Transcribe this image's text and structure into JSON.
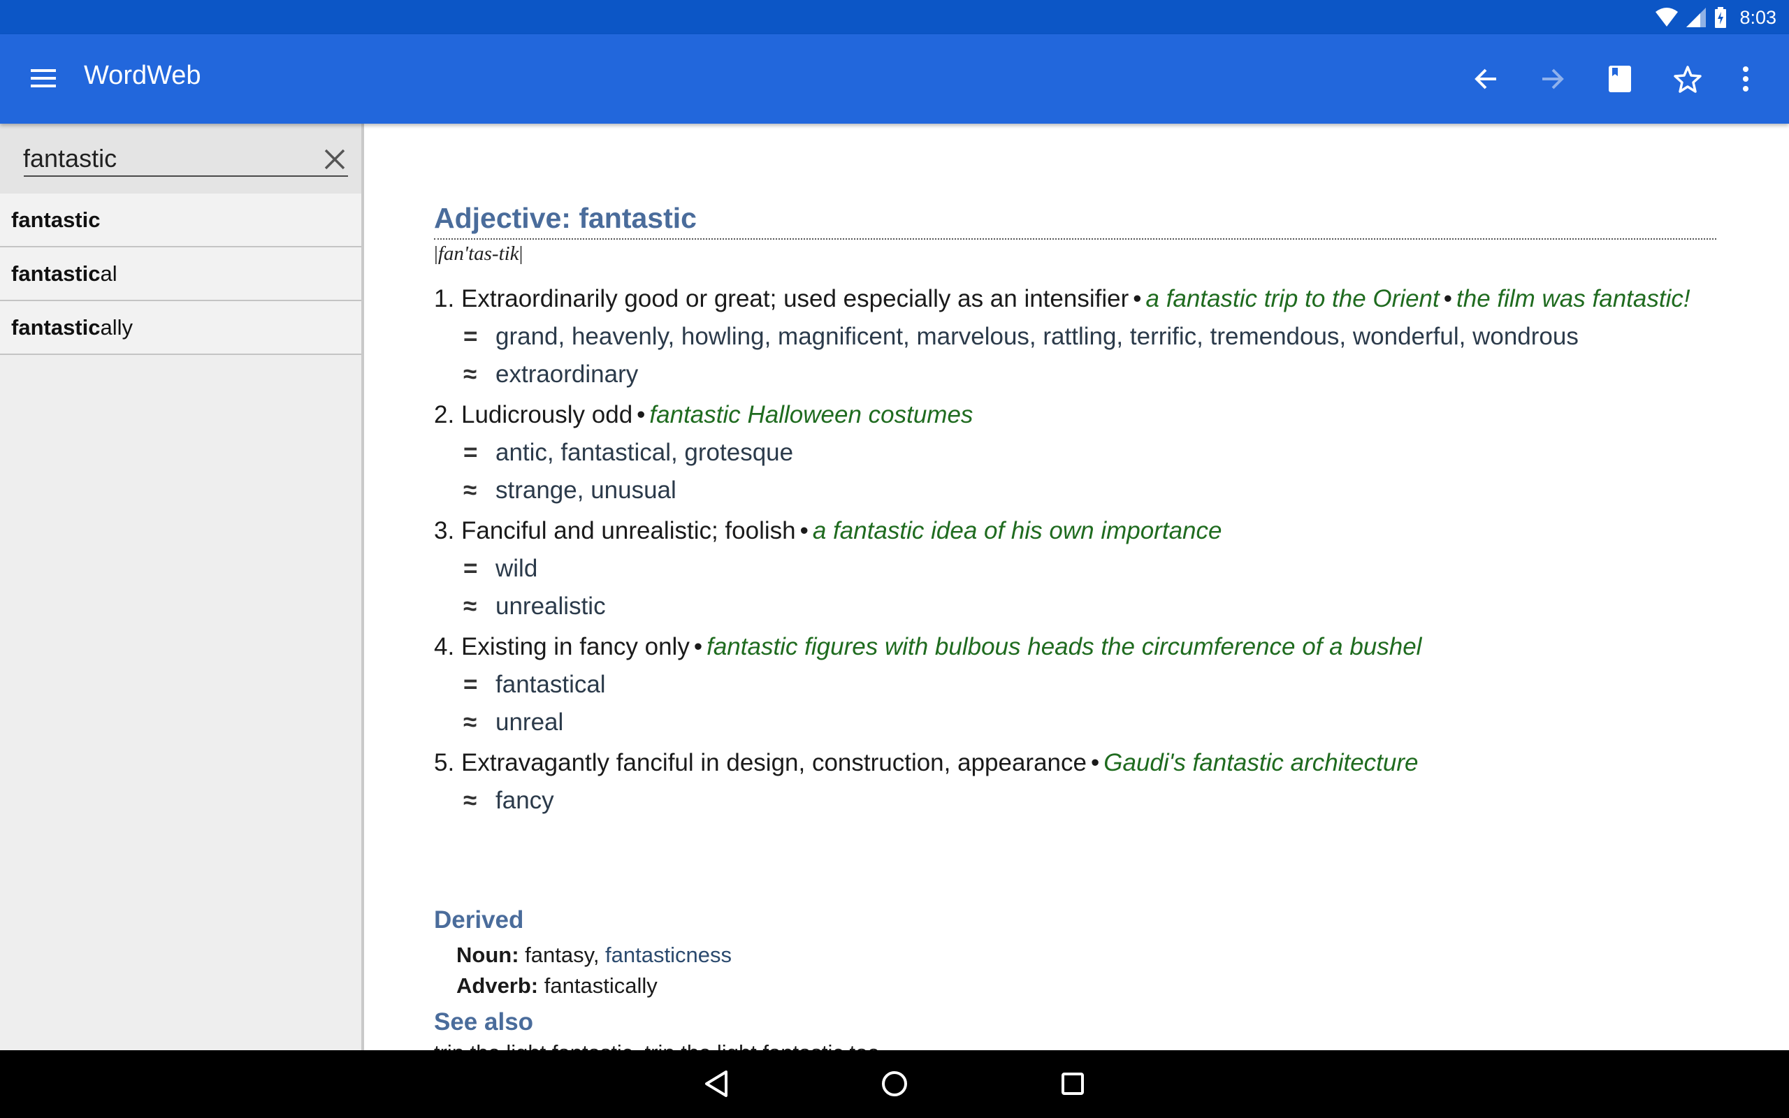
{
  "status_bar": {
    "time": "8:03",
    "icons": [
      "wifi-icon",
      "cell-signal-icon",
      "battery-charging-icon"
    ]
  },
  "app_bar": {
    "title": "WordWeb",
    "actions": [
      "menu-icon",
      "back-arrow-icon",
      "forward-arrow-icon",
      "book-icon",
      "star-icon",
      "more-vert-icon"
    ]
  },
  "search": {
    "value": "fantastic",
    "suggestions": [
      {
        "bold": "fantastic",
        "rest": ""
      },
      {
        "bold": "fantastic",
        "rest": "al"
      },
      {
        "bold": "fantastic",
        "rest": "ally"
      }
    ]
  },
  "entry": {
    "heading": "Adjective: fantastic",
    "pronunciation": "fan'tas-tik",
    "senses": [
      {
        "num": "1.",
        "definition": "Extraordinarily good or great; used especially as an intensifier",
        "examples": [
          "a fantastic trip to the Orient",
          "the film was fantastic!"
        ],
        "synonyms": "grand, heavenly, howling, magnificent, marvelous, rattling, terrific, tremendous, wonderful, wondrous",
        "similar": "extraordinary"
      },
      {
        "num": "2.",
        "definition": "Ludicrously odd",
        "examples": [
          "fantastic Halloween costumes"
        ],
        "synonyms": "antic, fantastical, grotesque",
        "similar": "strange, unusual"
      },
      {
        "num": "3.",
        "definition": "Fanciful and unrealistic; foolish",
        "examples": [
          "a fantastic idea of his own importance"
        ],
        "synonyms": "wild",
        "similar": "unrealistic"
      },
      {
        "num": "4.",
        "definition": "Existing in fancy only",
        "examples": [
          "fantastic figures with bulbous heads the circumference of a bushel"
        ],
        "synonyms": "fantastical",
        "similar": "unreal"
      },
      {
        "num": "5.",
        "definition": "Extravagantly fanciful in design, construction, appearance",
        "examples": [
          "Gaudi's fantastic architecture"
        ],
        "synonyms": null,
        "similar": "fancy"
      }
    ],
    "derived": {
      "heading": "Derived",
      "noun_label": "Noun:",
      "noun_word1": "fantasy",
      "noun_word2": "fantasticness",
      "adverb_label": "Adverb:",
      "adverb_word": "fantastically"
    },
    "see_also": {
      "heading": "See also",
      "partial_text": "trip the light fantastic, trip the light fantastic toe"
    }
  },
  "nav_bar": {
    "buttons": [
      "back-triangle-icon",
      "home-circle-icon",
      "recents-square-icon"
    ]
  },
  "colors": {
    "status_bar": "#0c56c6",
    "app_bar": "#2267dc",
    "heading_blue": "#4a6c9b",
    "example_green": "#1f6b1f"
  }
}
